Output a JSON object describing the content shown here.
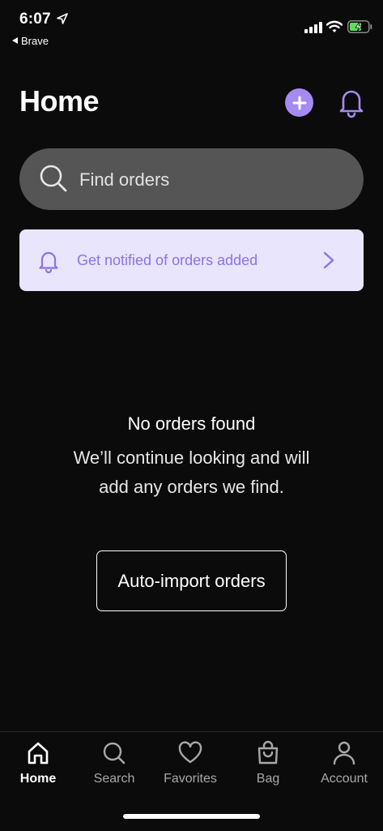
{
  "status_bar": {
    "time": "6:07",
    "back_app": "Brave"
  },
  "header": {
    "title": "Home"
  },
  "search": {
    "placeholder": "Find orders"
  },
  "notify_banner": {
    "text": "Get notified of orders added"
  },
  "empty_state": {
    "title": "No orders found",
    "message": "We’ll continue looking and will add any orders we find.",
    "button_label": "Auto-import orders"
  },
  "tab_bar": {
    "items": [
      {
        "label": "Home",
        "icon": "home-icon",
        "active": true
      },
      {
        "label": "Search",
        "icon": "search-icon",
        "active": false
      },
      {
        "label": "Favorites",
        "icon": "heart-icon",
        "active": false
      },
      {
        "label": "Bag",
        "icon": "bag-icon",
        "active": false
      },
      {
        "label": "Account",
        "icon": "person-icon",
        "active": false
      }
    ]
  },
  "colors": {
    "accent": "#a58bf0",
    "banner_bg": "#e9e5fd",
    "banner_text": "#8c72e6",
    "background": "#0b0b0b",
    "search_bg": "#555555"
  }
}
